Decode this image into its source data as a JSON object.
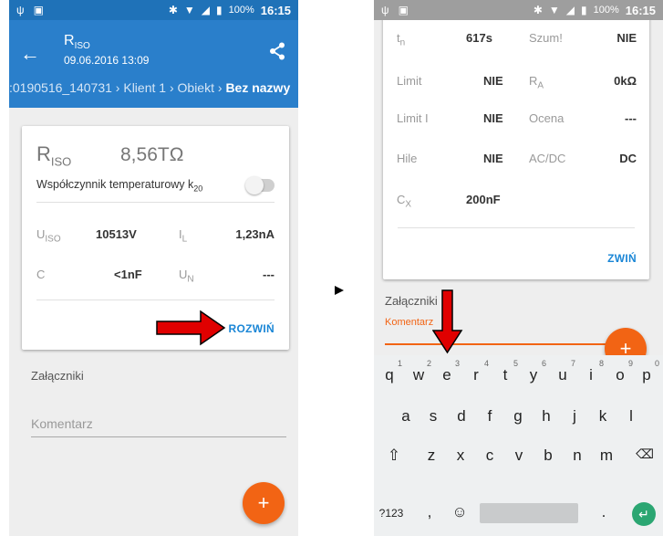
{
  "left": {
    "status": {
      "battery": "100%",
      "time": "16:15"
    },
    "appbar": {
      "title_main": "R",
      "title_sub": "ISO",
      "subtitle": "09.06.2016 13:09",
      "breadcrumb_1": ":0190516_140731",
      "breadcrumb_2": "Klient 1",
      "breadcrumb_3": "Obiekt",
      "breadcrumb_current": "Bez nazwy",
      "breadcrumb_sep": "›"
    },
    "card": {
      "main_label": "R",
      "main_label_sub": "ISO",
      "main_value": "8,56TΩ",
      "temp_coef_label": "Współczynnik temperaturowy k",
      "temp_coef_sub": "20",
      "params": [
        {
          "label": "U",
          "sub": "ISO",
          "value": "10513V"
        },
        {
          "label": "I",
          "sub": "L",
          "value": "1,23nA"
        },
        {
          "label": "C",
          "sub": "",
          "value": "<1nF"
        },
        {
          "label": "U",
          "sub": "N",
          "value": "---"
        }
      ],
      "expand_label": "ROZWIŃ"
    },
    "attachments_label": "Załączniki",
    "comment_placeholder": "Komentarz",
    "fab_label": "+"
  },
  "right": {
    "status": {
      "battery": "100%",
      "time": "16:15"
    },
    "card": {
      "rows": [
        {
          "l1": "t",
          "l1sub": "n",
          "v1": "617s",
          "l2": "Szum!",
          "l2sub": "",
          "v2": "NIE"
        },
        {
          "l1": "Limit",
          "l1sub": "",
          "v1": "NIE",
          "l2": "R",
          "l2sub": "A",
          "v2": "0kΩ"
        },
        {
          "l1": "Limit I",
          "l1sub": "",
          "v1": "NIE",
          "l2": "Ocena",
          "l2sub": "",
          "v2": "---"
        },
        {
          "l1": "Hile",
          "l1sub": "",
          "v1": "NIE",
          "l2": "AC/DC",
          "l2sub": "",
          "v2": "DC"
        },
        {
          "l1": "C",
          "l1sub": "X",
          "v1": "200nF",
          "l2": "",
          "l2sub": "",
          "v2": ""
        }
      ],
      "collapse_label": "ZWIŃ"
    },
    "attachments_label": "Załączniki",
    "comment_label": "Komentarz",
    "fab_label": "+",
    "keyboard": {
      "row1": [
        "q",
        "w",
        "e",
        "r",
        "t",
        "y",
        "u",
        "i",
        "o",
        "p"
      ],
      "row1_hints": [
        "1",
        "2",
        "3",
        "4",
        "5",
        "6",
        "7",
        "8",
        "9",
        "0"
      ],
      "row2": [
        "a",
        "s",
        "d",
        "f",
        "g",
        "h",
        "j",
        "k",
        "l"
      ],
      "row3": [
        "z",
        "x",
        "c",
        "v",
        "b",
        "n",
        "m"
      ],
      "symbols_key": "?123",
      "comma_key": ",",
      "period_key": "."
    }
  },
  "colors": {
    "appbar": "#2a7fcb",
    "accent_link": "#1a86d6",
    "fab": "#f26414",
    "highlight_arrow": "#e00000",
    "enter_key": "#2ba672"
  }
}
